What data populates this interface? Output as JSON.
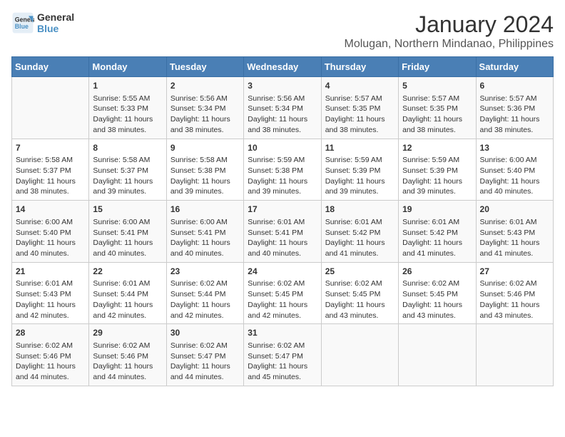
{
  "header": {
    "logo_line1": "General",
    "logo_line2": "Blue",
    "title": "January 2024",
    "subtitle": "Molugan, Northern Mindanao, Philippines"
  },
  "days_of_week": [
    "Sunday",
    "Monday",
    "Tuesday",
    "Wednesday",
    "Thursday",
    "Friday",
    "Saturday"
  ],
  "weeks": [
    [
      {
        "day": "",
        "content": ""
      },
      {
        "day": "1",
        "content": "Sunrise: 5:55 AM\nSunset: 5:33 PM\nDaylight: 11 hours\nand 38 minutes."
      },
      {
        "day": "2",
        "content": "Sunrise: 5:56 AM\nSunset: 5:34 PM\nDaylight: 11 hours\nand 38 minutes."
      },
      {
        "day": "3",
        "content": "Sunrise: 5:56 AM\nSunset: 5:34 PM\nDaylight: 11 hours\nand 38 minutes."
      },
      {
        "day": "4",
        "content": "Sunrise: 5:57 AM\nSunset: 5:35 PM\nDaylight: 11 hours\nand 38 minutes."
      },
      {
        "day": "5",
        "content": "Sunrise: 5:57 AM\nSunset: 5:35 PM\nDaylight: 11 hours\nand 38 minutes."
      },
      {
        "day": "6",
        "content": "Sunrise: 5:57 AM\nSunset: 5:36 PM\nDaylight: 11 hours\nand 38 minutes."
      }
    ],
    [
      {
        "day": "7",
        "content": "Sunrise: 5:58 AM\nSunset: 5:37 PM\nDaylight: 11 hours\nand 38 minutes."
      },
      {
        "day": "8",
        "content": "Sunrise: 5:58 AM\nSunset: 5:37 PM\nDaylight: 11 hours\nand 39 minutes."
      },
      {
        "day": "9",
        "content": "Sunrise: 5:58 AM\nSunset: 5:38 PM\nDaylight: 11 hours\nand 39 minutes."
      },
      {
        "day": "10",
        "content": "Sunrise: 5:59 AM\nSunset: 5:38 PM\nDaylight: 11 hours\nand 39 minutes."
      },
      {
        "day": "11",
        "content": "Sunrise: 5:59 AM\nSunset: 5:39 PM\nDaylight: 11 hours\nand 39 minutes."
      },
      {
        "day": "12",
        "content": "Sunrise: 5:59 AM\nSunset: 5:39 PM\nDaylight: 11 hours\nand 39 minutes."
      },
      {
        "day": "13",
        "content": "Sunrise: 6:00 AM\nSunset: 5:40 PM\nDaylight: 11 hours\nand 40 minutes."
      }
    ],
    [
      {
        "day": "14",
        "content": "Sunrise: 6:00 AM\nSunset: 5:40 PM\nDaylight: 11 hours\nand 40 minutes."
      },
      {
        "day": "15",
        "content": "Sunrise: 6:00 AM\nSunset: 5:41 PM\nDaylight: 11 hours\nand 40 minutes."
      },
      {
        "day": "16",
        "content": "Sunrise: 6:00 AM\nSunset: 5:41 PM\nDaylight: 11 hours\nand 40 minutes."
      },
      {
        "day": "17",
        "content": "Sunrise: 6:01 AM\nSunset: 5:41 PM\nDaylight: 11 hours\nand 40 minutes."
      },
      {
        "day": "18",
        "content": "Sunrise: 6:01 AM\nSunset: 5:42 PM\nDaylight: 11 hours\nand 41 minutes."
      },
      {
        "day": "19",
        "content": "Sunrise: 6:01 AM\nSunset: 5:42 PM\nDaylight: 11 hours\nand 41 minutes."
      },
      {
        "day": "20",
        "content": "Sunrise: 6:01 AM\nSunset: 5:43 PM\nDaylight: 11 hours\nand 41 minutes."
      }
    ],
    [
      {
        "day": "21",
        "content": "Sunrise: 6:01 AM\nSunset: 5:43 PM\nDaylight: 11 hours\nand 42 minutes."
      },
      {
        "day": "22",
        "content": "Sunrise: 6:01 AM\nSunset: 5:44 PM\nDaylight: 11 hours\nand 42 minutes."
      },
      {
        "day": "23",
        "content": "Sunrise: 6:02 AM\nSunset: 5:44 PM\nDaylight: 11 hours\nand 42 minutes."
      },
      {
        "day": "24",
        "content": "Sunrise: 6:02 AM\nSunset: 5:45 PM\nDaylight: 11 hours\nand 42 minutes."
      },
      {
        "day": "25",
        "content": "Sunrise: 6:02 AM\nSunset: 5:45 PM\nDaylight: 11 hours\nand 43 minutes."
      },
      {
        "day": "26",
        "content": "Sunrise: 6:02 AM\nSunset: 5:45 PM\nDaylight: 11 hours\nand 43 minutes."
      },
      {
        "day": "27",
        "content": "Sunrise: 6:02 AM\nSunset: 5:46 PM\nDaylight: 11 hours\nand 43 minutes."
      }
    ],
    [
      {
        "day": "28",
        "content": "Sunrise: 6:02 AM\nSunset: 5:46 PM\nDaylight: 11 hours\nand 44 minutes."
      },
      {
        "day": "29",
        "content": "Sunrise: 6:02 AM\nSunset: 5:46 PM\nDaylight: 11 hours\nand 44 minutes."
      },
      {
        "day": "30",
        "content": "Sunrise: 6:02 AM\nSunset: 5:47 PM\nDaylight: 11 hours\nand 44 minutes."
      },
      {
        "day": "31",
        "content": "Sunrise: 6:02 AM\nSunset: 5:47 PM\nDaylight: 11 hours\nand 45 minutes."
      },
      {
        "day": "",
        "content": ""
      },
      {
        "day": "",
        "content": ""
      },
      {
        "day": "",
        "content": ""
      }
    ]
  ]
}
